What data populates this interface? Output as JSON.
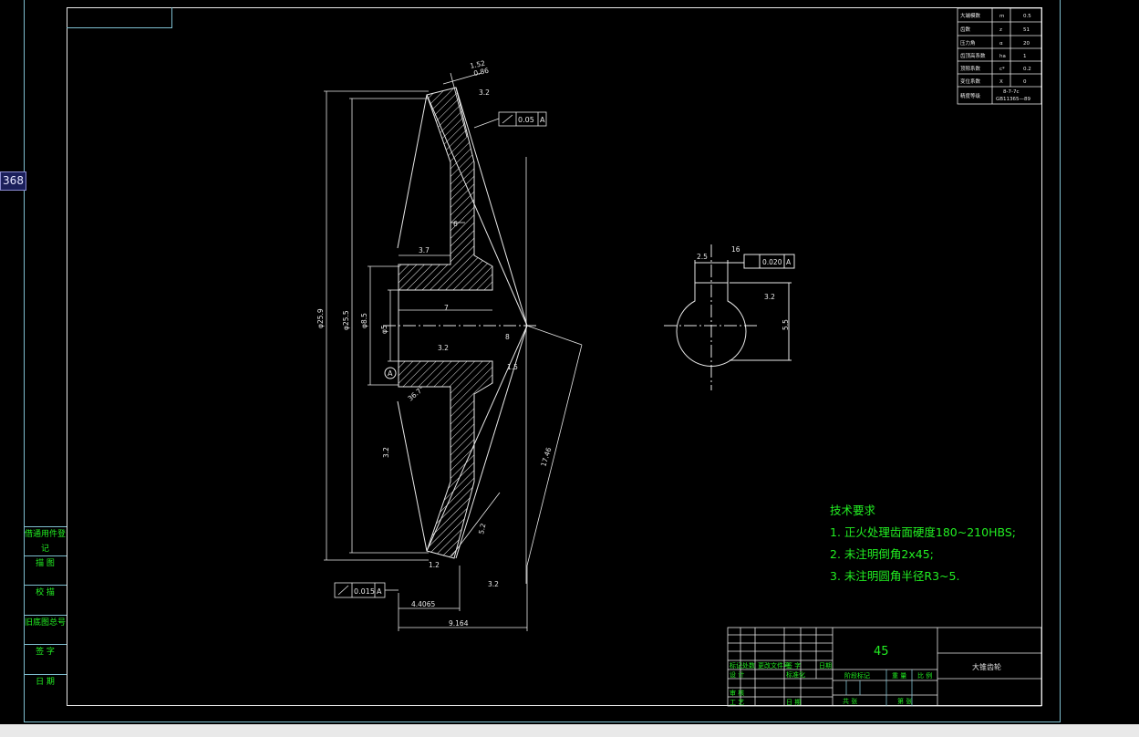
{
  "coordinate_badge": "368",
  "param_table": {
    "rows": [
      {
        "name": "大端模数",
        "symbol": "m",
        "value": "0.5"
      },
      {
        "name": "齿数",
        "symbol": "z",
        "value": "51"
      },
      {
        "name": "压力角",
        "symbol": "α",
        "value": "20"
      },
      {
        "name": "齿顶高系数",
        "symbol": "ha",
        "value": "1"
      },
      {
        "name": "顶隙系数",
        "symbol": "c*",
        "value": "0.2"
      },
      {
        "name": "变位系数",
        "symbol": "X",
        "value": "0"
      },
      {
        "name": "精度等级",
        "symbol": "",
        "value": "8-7-7c"
      }
    ],
    "standard": "GB11365—89"
  },
  "dimensions": {
    "d_outer": "φ25.9",
    "d_pitch": "φ25.5",
    "d_hub": "φ8.5",
    "d_bore": "φ5",
    "hub_len": "3.7",
    "bore_len": "7",
    "web": "6",
    "rough_hub": "3.2",
    "rough_top": "3.2",
    "rough_face": "3.2",
    "rough_bottom": "3.2",
    "rough_left": "3.2",
    "top_width": "1.52",
    "top_width2": "0.86",
    "len_cone": "17.46",
    "chamfer": "5.2",
    "dim_bottom1": "4.4065",
    "dim_bottom2": "9.164",
    "angle_label": "36.7°",
    "key_width": "2.5",
    "key_depth": "5.5",
    "key_rough": "3.2",
    "key_small": "16",
    "datum": "A",
    "runout_top": "0.05",
    "runout_bottom": "0.015",
    "symmetry": "0.020",
    "small_a": "1.5",
    "small_b": "1.2",
    "small_c": "8"
  },
  "tech_requirements": {
    "title": "技术要求",
    "items": [
      "1. 正火处理齿面硬度180~210HBS;",
      "2. 未注明倒角2x45;",
      "3. 未注明圆角半径R3~5."
    ]
  },
  "side_labels": [
    "借通用件登记",
    "描 图",
    "校 描",
    "旧底图总号",
    "签 字",
    "日 期"
  ],
  "title_block": {
    "material": "45",
    "part_name": "大锥齿轮",
    "row_labels": [
      "标记",
      "处数",
      "更改文件号",
      "签 字",
      "日期"
    ],
    "cells": [
      "设 计",
      "标准化",
      "审 核",
      "工 艺",
      "日 期"
    ],
    "stage": "阶段标记",
    "weight": "重 量",
    "scale": "比 例",
    "sheet": "共  张",
    "sheet2": "第  张"
  },
  "colors": {
    "line": "#e8e8e8",
    "cyan": "#7fbfd0",
    "green": "#22ee22"
  }
}
